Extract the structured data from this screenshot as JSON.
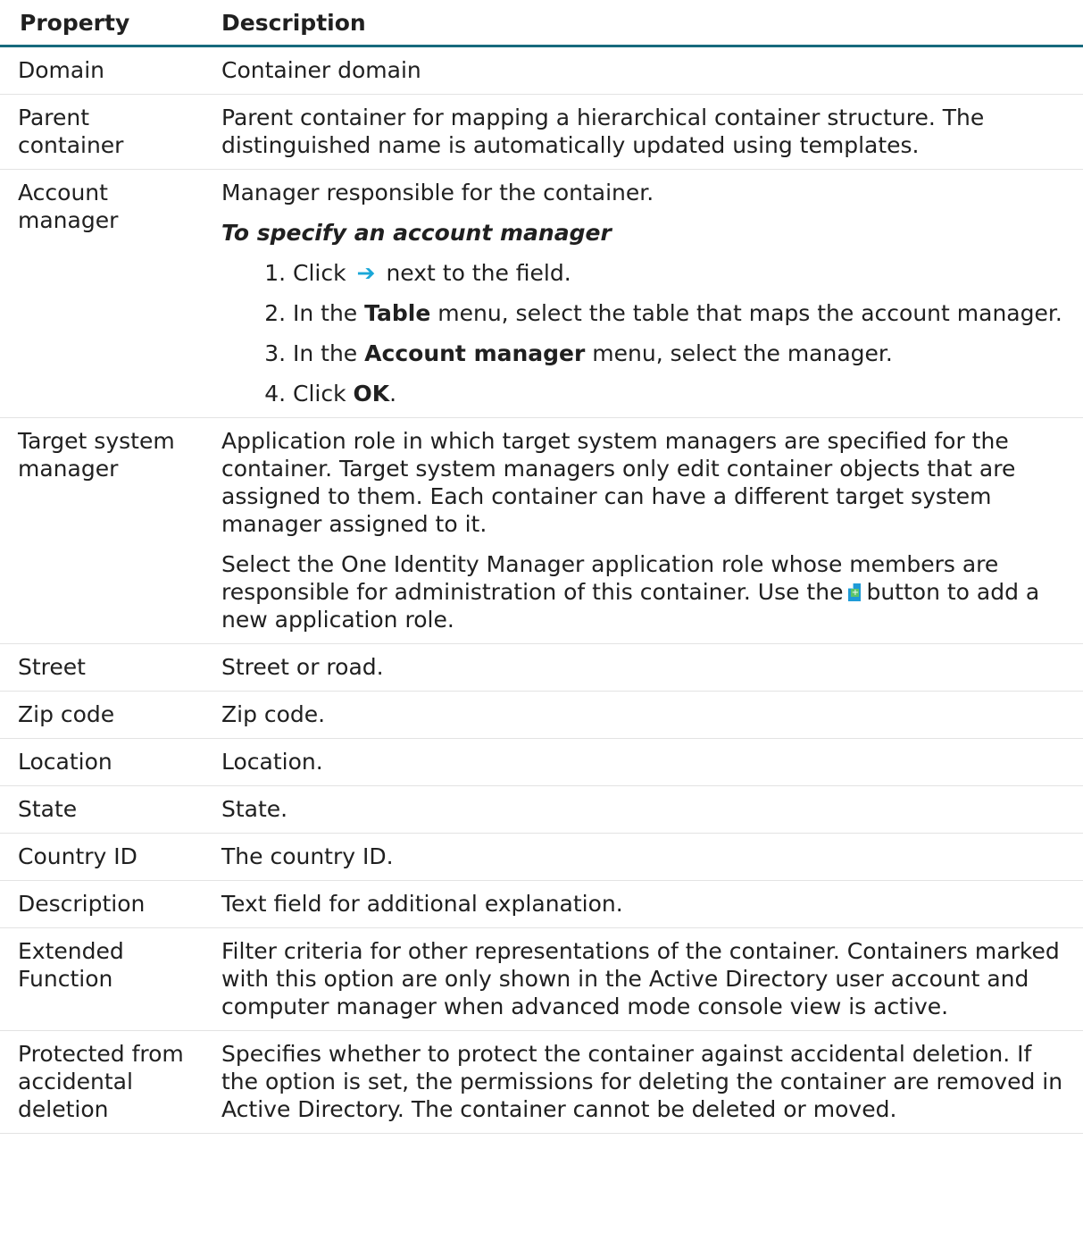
{
  "header": {
    "property": "Property",
    "description": "Description"
  },
  "rows": {
    "domain": {
      "property": "Domain",
      "description": "Container domain"
    },
    "parent": {
      "property": "Parent container",
      "description": "Parent container for mapping a hierarchical container structure. The distinguished name is automatically updated using templates."
    },
    "account_manager": {
      "property": "Account manager",
      "description": "Manager responsible for the container.",
      "procedure_title": "To specify an account manager",
      "steps": {
        "s1_a": "Click",
        "s1_b": "next to the field.",
        "s2_a": "In the",
        "s2_bold": "Table",
        "s2_b": "menu, select the table that maps the account manager.",
        "s3_a": "In the",
        "s3_bold": "Account manager",
        "s3_b": "menu, select the manager.",
        "s4_a": "Click",
        "s4_bold": "OK",
        "s4_b": "."
      }
    },
    "target_system_manager": {
      "property": "Target system manager",
      "description1": "Application role in which target system managers are specified for the container. Target system managers only edit container objects that are assigned to them. Each container can have a different target system manager assigned to it.",
      "description2_a": "Select the One Identity Manager application role whose members are responsible for administration of this container. Use the",
      "description2_b": "button to add a new application role."
    },
    "street": {
      "property": "Street",
      "description": "Street or road."
    },
    "zip": {
      "property": "Zip code",
      "description": "Zip code."
    },
    "location": {
      "property": "Location",
      "description": "Location."
    },
    "state": {
      "property": "State",
      "description": "State."
    },
    "country": {
      "property": "Country ID",
      "description": "The country ID."
    },
    "description": {
      "property": "Description",
      "description": "Text field for additional explanation."
    },
    "extended": {
      "property": "Extended Function",
      "description": "Filter criteria for other representations of the container. Containers marked with this option are only shown in the Active Directory user account and computer manager when advanced mode console view is active."
    },
    "protected": {
      "property": "Protected from accidental deletion",
      "description": "Specifies whether to protect the container against accidental deletion. If the option is set, the permissions for deleting the container are removed in Active Directory. The container cannot be deleted or moved."
    }
  },
  "icons": {
    "arrow": "arrow-right-icon",
    "new_role": "new-document-icon"
  },
  "colors": {
    "header_rule": "#176a7d",
    "arrow": "#1aa7d8",
    "new_icon": "#1f9bd7"
  }
}
